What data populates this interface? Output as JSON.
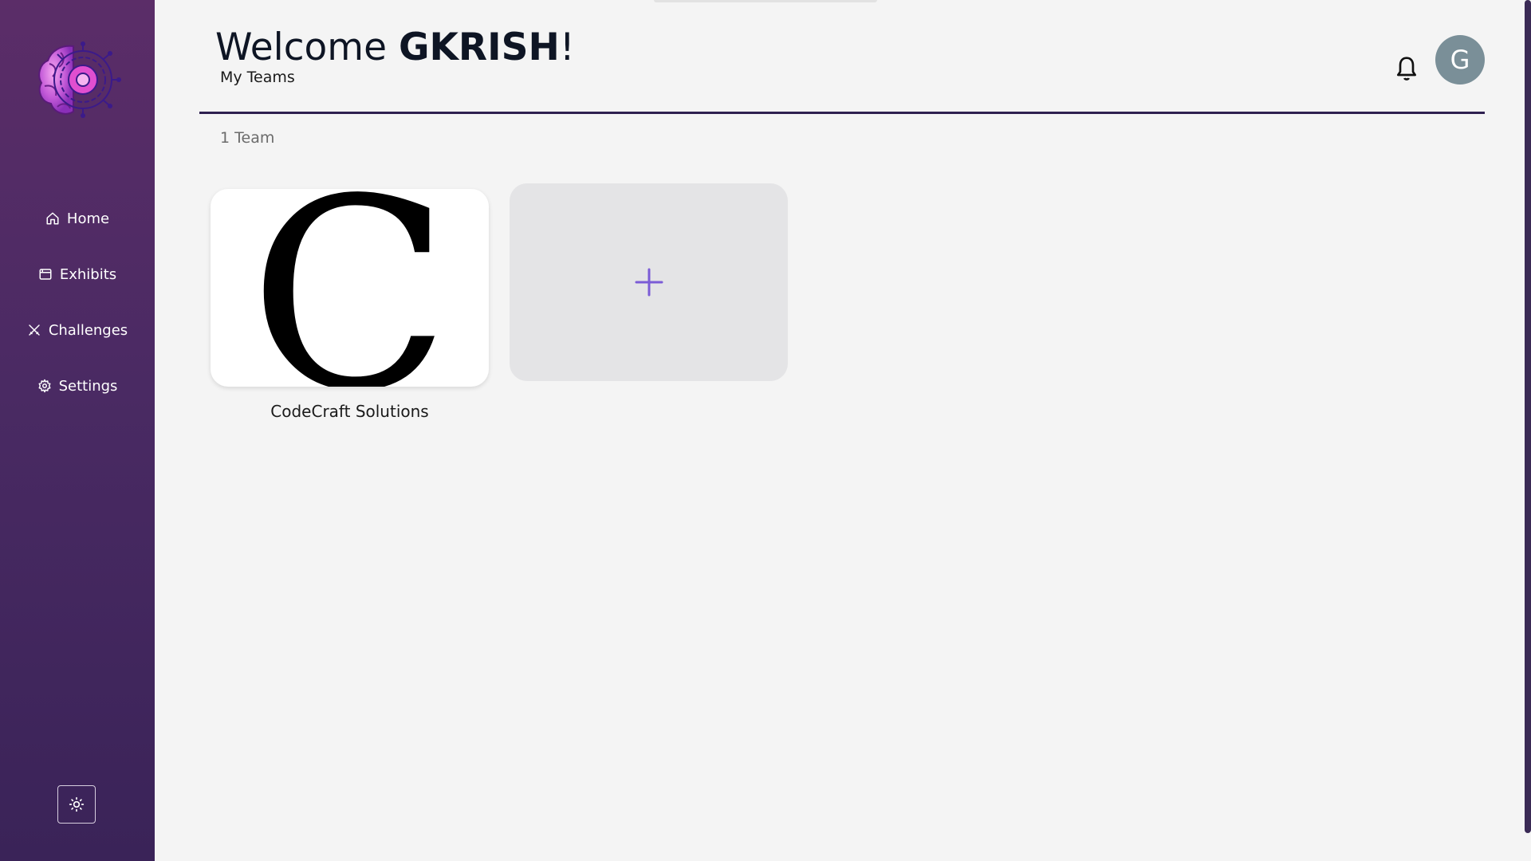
{
  "header": {
    "welcome_prefix": "Welcome ",
    "username": "GKRISH",
    "welcome_suffix": "!",
    "subtitle": "My Teams",
    "avatar_initial": "G"
  },
  "sidebar": {
    "items": [
      {
        "label": "Home",
        "icon": "home-icon"
      },
      {
        "label": "Exhibits",
        "icon": "exhibits-icon"
      },
      {
        "label": "Challenges",
        "icon": "swords-icon"
      },
      {
        "label": "Settings",
        "icon": "gear-icon"
      }
    ],
    "theme_toggle_icon": "sun-icon"
  },
  "teams": {
    "count_label": "1 Team",
    "items": [
      {
        "name": "CodeCraft Solutions",
        "logo_letter": "C"
      }
    ],
    "add_icon": "plus-icon"
  },
  "colors": {
    "sidebar_top": "#5b2d68",
    "sidebar_bottom": "#3a2358",
    "accent": "#7b5cd6",
    "divider": "#2e2050",
    "avatar": "#7a8f98"
  }
}
